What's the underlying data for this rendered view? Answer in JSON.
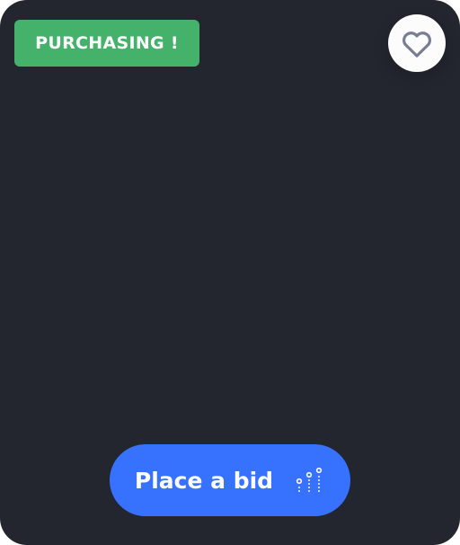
{
  "card": {
    "status_badge": "PURCHASING !",
    "favorite_icon": "heart-icon",
    "bid_button_label": "Place a bid",
    "bid_button_icon": "scatter-dots-icon"
  },
  "colors": {
    "card_background": "#23262f",
    "badge_background": "#45b26b",
    "button_background": "#3772ff",
    "button_text": "#fcfcfd",
    "icon_stroke": "#777e90"
  }
}
